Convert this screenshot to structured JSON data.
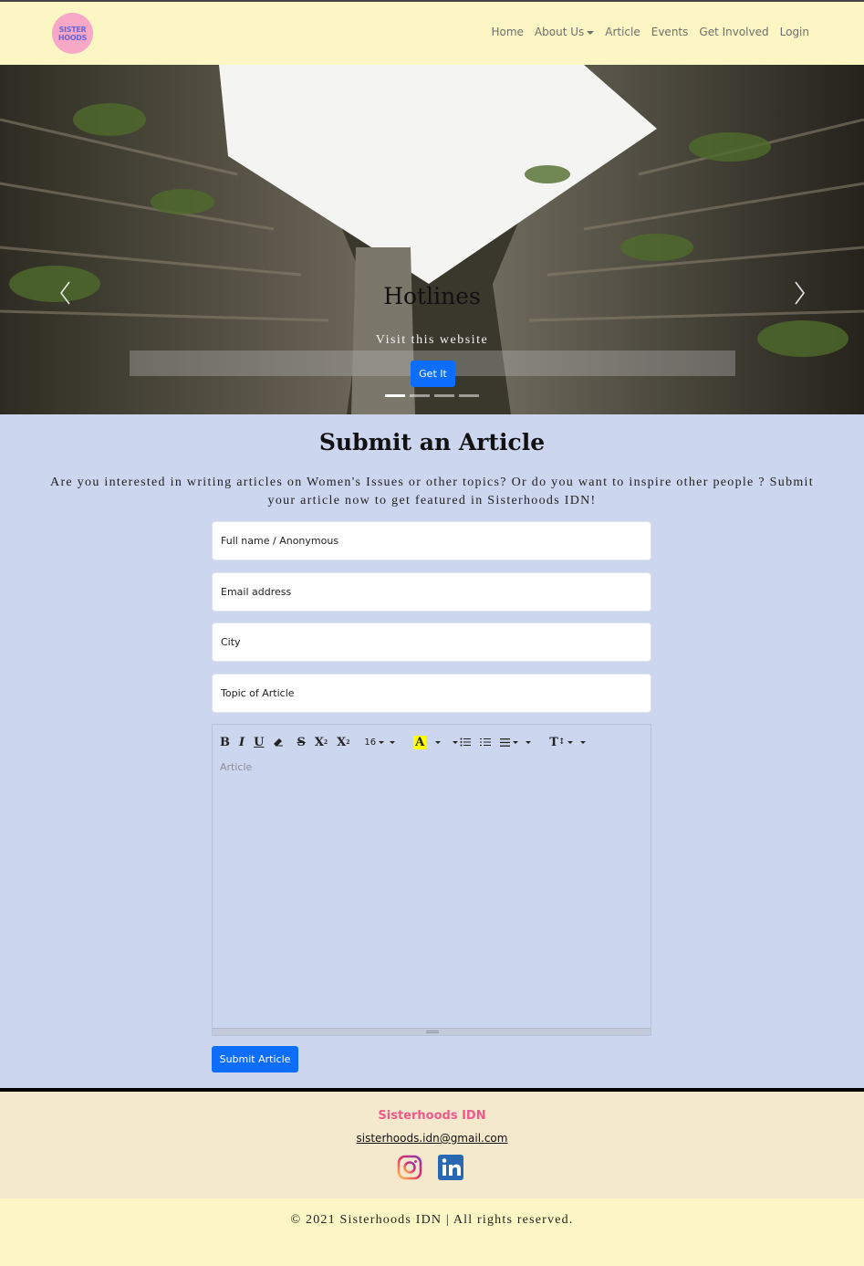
{
  "nav": {
    "logo_line1": "SISTER",
    "logo_line2": "HOODS",
    "items": [
      {
        "label": "Home"
      },
      {
        "label": "About Us"
      },
      {
        "label": "Article"
      },
      {
        "label": "Events"
      },
      {
        "label": "Get Involved"
      },
      {
        "label": "Login"
      }
    ]
  },
  "hero": {
    "title": "Hotlines",
    "subtitle": "Visit this website",
    "button": "Get It",
    "slides": 4,
    "active_slide": 1,
    "icons": [
      "chevron-left-icon",
      "chevron-right-icon"
    ]
  },
  "form": {
    "title": "Submit an Article",
    "intro": "Are you interested in writing articles on Women's Issues or other topics? Or do you want to inspire other people ? Submit your article now to get featured in Sisterhoods IDN!",
    "name_placeholder": "Full name / Anonymous",
    "email_placeholder": "Email address",
    "city_placeholder": "City",
    "topic_placeholder": "Topic of Article",
    "toolbar": {
      "bold": "B",
      "italic": "I",
      "underline": "U",
      "strike": "S",
      "superscript": "X",
      "subscript": "X",
      "font_size": "16",
      "color_letter": "A",
      "height_label": "T"
    },
    "article_placeholder": "Article",
    "submit": "Submit Article"
  },
  "footer": {
    "brand": "Sisterhoods IDN",
    "email": "sisterhoods.idn@gmail.com",
    "copyright": "© 2021 Sisterhoods IDN | All rights reserved.",
    "social": [
      "instagram-icon",
      "linkedin-icon"
    ]
  },
  "colors": {
    "navbar_bg": "#fcf5c4",
    "page_bg": "#cdd6ef",
    "primary_button": "#0d6efd",
    "brand_pink": "#f05a8a",
    "footer_bg": "#f4e8cd"
  }
}
